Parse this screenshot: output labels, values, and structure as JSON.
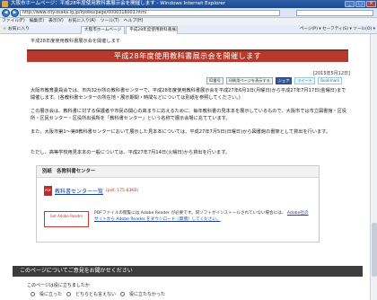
{
  "window": {
    "title": "大阪市ホームページ：平成28年度使用教科書展示会を開催します - Windows Internet Explorer",
    "min_label": "_",
    "max_label": "□",
    "close_label": "×"
  },
  "addressbar": {
    "url": "http://www.city.osaka.lg.jp/kyoiku/page/0000318001.html"
  },
  "menu": [
    "ファイル(F)",
    "編集(E)",
    "表示(V)",
    "お気に入り(A)",
    "ツール(T)",
    "ヘルプ(H)"
  ],
  "favorites": {
    "label": "お気に入り",
    "tabs": [
      "大阪市ホームページ",
      "平成28年度使用教科書展示会..."
    ],
    "commands": "ページ(P) ▾  セーフティ(S) ▾  ツール(O) ▾"
  },
  "page": {
    "breadcrumb": "平成28年度使用教科書展示会を開催します",
    "title": "平成28年度使用教科書展示会を開催します",
    "date": "[2015年5月12日]",
    "share": {
      "ids_label": "ID番号",
      "print_label": "印刷用ページを表示する",
      "share_label": "シェア",
      "tweet_label": "ツイート",
      "bookmark_label": "Bookmark"
    },
    "paragraphs": [
      "大阪市教育委員会では、市内32か所の教科書センターで、平成28年度使用教科書展示会を平成27年6月1日(月曜日)から平成27年7月17日(金曜日)まで開催します。(各教科書センターの所在地・展示期間・時間などについては別紙を参照してください。)",
      "この展示会は、教科書に対する保護者や市民の関心の高まりに応えるために、毎年教科書の見本本を展示しているもので、大阪市では市立図書館・区役所・区民センター・区役所出張所を「教科書センター」という名称で展示会場に充てています。",
      "また、大阪市第1～第8教科書センターにおいて展示した見本本については、平成27年7月5日(日曜日)から図書館の書架として貸出を行います。",
      "ただし、高等学校用見本本の一般については、平成27年7月14日(火曜日)から貸出を行います。"
    ],
    "doc_box": {
      "heading": "別紙　各教科書センター",
      "pdf_icon": "PDF",
      "pdf_link": "教科書センター一覧",
      "pdf_size": "(pdf, 175.83KB)",
      "adobe_badge": "Get Adobe Reader",
      "adobe_text_1": "PDFファイルの閲覧には Adobe Reader が必要です。同ソフトがインストールされていない場合には、",
      "adobe_link": "Adobe社のサイトから Adobe Reader をダウンロード（無償）してください。"
    },
    "opinion": {
      "heading": "このページについてご意見をお聞かせください",
      "question": "このページは役に立ちましたか",
      "options": [
        "役に立った",
        "どちらとも言えない",
        "役に立たなかった"
      ]
    }
  },
  "colors": {
    "banner": "#b33a2c",
    "titlebar": "#2f5fa8",
    "opinion_bar": "#3c3c3c",
    "link": "#1a3fa0"
  }
}
